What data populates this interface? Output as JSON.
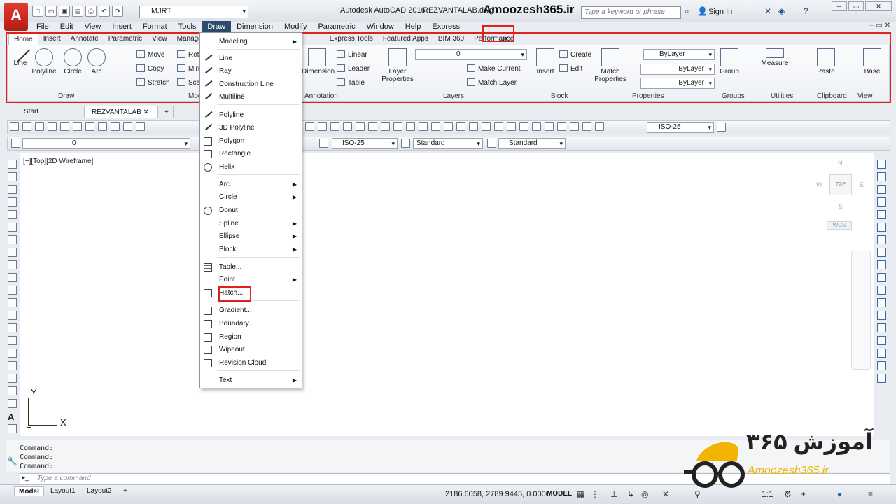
{
  "window": {
    "app_title": "Autodesk AutoCAD 2016",
    "file_title": "REZVANTALAB.dwg",
    "brand_title": "Amoozesh365.ir",
    "workspace": "MJRT",
    "search_placeholder": "Type a keyword or phrase",
    "sign_in": "Sign In"
  },
  "menubar": [
    "File",
    "Edit",
    "View",
    "Insert",
    "Format",
    "Tools",
    "Draw",
    "Dimension",
    "Modify",
    "Parametric",
    "Window",
    "Help",
    "Express"
  ],
  "ribbon_tabs": [
    "Home",
    "Insert",
    "Annotate",
    "Parametric",
    "View",
    "Manage",
    "Express Tools",
    "Featured Apps",
    "BIM 360",
    "Performance"
  ],
  "ribbon": {
    "draw": {
      "title": "Draw",
      "line": "Line",
      "polyline": "Polyline",
      "circle": "Circle",
      "arc": "Arc"
    },
    "modify": {
      "title": "Modify",
      "move": "Move",
      "copy": "Copy",
      "stretch": "Stretch",
      "rotate": "Rotate",
      "mirror": "Mirror",
      "scale": "Scale"
    },
    "annotation": {
      "title": "Annotation",
      "dimension": "Dimension",
      "linear": "Linear",
      "leader": "Leader",
      "table": "Table"
    },
    "layers": {
      "title": "Layers",
      "layer_properties": "Layer Properties",
      "layer_value": "0",
      "make_current": "Make Current",
      "match_layer": "Match Layer"
    },
    "block": {
      "title": "Block",
      "insert": "Insert",
      "create": "Create",
      "edit": "Edit"
    },
    "properties": {
      "title": "Properties",
      "match_properties": "Match Properties",
      "color": "ByLayer",
      "linetype": "ByLayer",
      "lineweight": "ByLayer"
    },
    "groups": {
      "title": "Groups",
      "group": "Group"
    },
    "utilities": {
      "title": "Utilities",
      "measure": "Measure"
    },
    "clipboard": {
      "title": "Clipboard",
      "paste": "Paste"
    },
    "view": {
      "title": "View",
      "base": "Base"
    }
  },
  "file_tabs": {
    "start": "Start",
    "active": "REZVANTALAB"
  },
  "toolbars": {
    "dimstyle": "ISO-25",
    "layer": "0",
    "dimstyle2": "ISO-25",
    "textstyle": "Standard",
    "tablestyle": "Standard"
  },
  "viewport": {
    "label": "[−][Top][2D Wireframe]",
    "viewcube_top": "TOP",
    "north": "N",
    "south": "S",
    "east": "E",
    "west": "W",
    "wcs": "WCS",
    "ucs_x": "X",
    "ucs_y": "Y"
  },
  "draw_menu": {
    "items": [
      {
        "label": "Modeling",
        "sub": true
      },
      {
        "label": "Line"
      },
      {
        "label": "Ray"
      },
      {
        "label": "Construction Line"
      },
      {
        "label": "Multiline"
      },
      {
        "label": "Polyline"
      },
      {
        "label": "3D Polyline"
      },
      {
        "label": "Polygon"
      },
      {
        "label": "Rectangle"
      },
      {
        "label": "Helix"
      },
      {
        "label": "Arc",
        "sub": true
      },
      {
        "label": "Circle",
        "sub": true
      },
      {
        "label": "Donut"
      },
      {
        "label": "Spline",
        "sub": true
      },
      {
        "label": "Ellipse",
        "sub": true
      },
      {
        "label": "Block",
        "sub": true
      },
      {
        "label": "Table..."
      },
      {
        "label": "Point",
        "sub": true
      },
      {
        "label": "Hatch..."
      },
      {
        "label": "Gradient..."
      },
      {
        "label": "Boundary..."
      },
      {
        "label": "Region"
      },
      {
        "label": "Wipeout"
      },
      {
        "label": "Revision Cloud"
      },
      {
        "label": "Text",
        "sub": true
      }
    ]
  },
  "command": {
    "lines": [
      "Command:",
      "Command:",
      "Command:"
    ],
    "placeholder": "Type a command"
  },
  "statusbar": {
    "tabs": [
      "Model",
      "Layout1",
      "Layout2"
    ],
    "coords": "2186.6058, 2789.9445, 0.0000",
    "space": "MODEL",
    "scale": "1:1"
  },
  "brand_logo": {
    "text_latin": "Amoozesh365.ir",
    "text_fa": "آموزش ۳۶۵"
  },
  "colors": {
    "accent_red": "#e0201e",
    "menu_active": "#2e4a6c",
    "brand_yellow": "#f2b400"
  }
}
